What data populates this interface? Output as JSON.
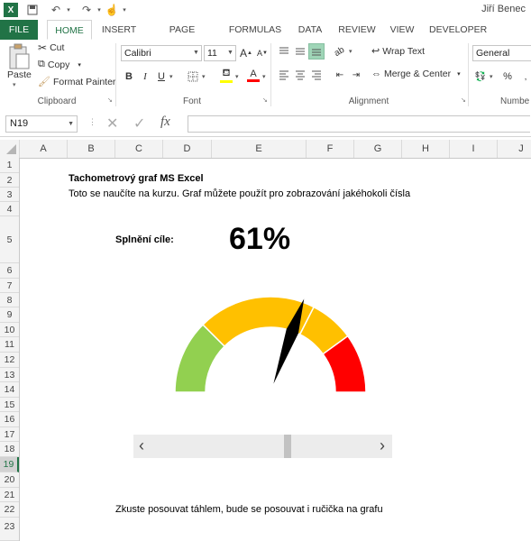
{
  "window": {
    "user_name": "Jiří Benec"
  },
  "tabs": [
    "FILE",
    "HOME",
    "INSERT",
    "PAGE LAYOUT",
    "FORMULAS",
    "DATA",
    "REVIEW",
    "VIEW",
    "DEVELOPER"
  ],
  "clipboard": {
    "paste": "Paste",
    "cut": "Cut",
    "copy": "Copy",
    "format_painter": "Format Painter",
    "group": "Clipboard"
  },
  "font": {
    "name": "Calibri",
    "size": "11",
    "group": "Font",
    "bold": "B",
    "italic": "I",
    "underline": "U",
    "grow": "A",
    "shrink": "A"
  },
  "alignment": {
    "wrap": "Wrap Text",
    "merge": "Merge & Center",
    "group": "Alignment"
  },
  "number": {
    "format": "General",
    "group": "Numbe",
    "percent": "%"
  },
  "formula_bar": {
    "name_box": "N19",
    "fx": "fx",
    "value": ""
  },
  "columns": [
    "A",
    "B",
    "C",
    "D",
    "E",
    "F",
    "G",
    "H",
    "I",
    "J"
  ],
  "rows": [
    "1",
    "2",
    "3",
    "4",
    "5",
    "6",
    "7",
    "8",
    "9",
    "10",
    "11",
    "12",
    "13",
    "14",
    "15",
    "16",
    "17",
    "18",
    "19",
    "20",
    "21",
    "22",
    "23"
  ],
  "selected_cell": {
    "column": "N",
    "row": "19"
  },
  "sheet": {
    "title": "Tachometrový graf MS Excel",
    "subtitle": "Toto se naučíte na kurzu. Graf můžete použít pro zobrazování jakéhokoli čísla",
    "goal_label": "Splnění cíle:",
    "goal_value": "61%",
    "hint": "Zkuste posouvat táhlem, bude se posouvat i ručička na grafu"
  },
  "gauge": {
    "value": 0.61,
    "segments": [
      {
        "from": 0.0,
        "to": 0.25,
        "color": "#92d050"
      },
      {
        "from": 0.25,
        "to": 0.65,
        "color": "#ffc000"
      },
      {
        "from": 0.65,
        "to": 0.8,
        "color": "#ffc000"
      },
      {
        "from": 0.8,
        "to": 1.0,
        "color": "#ff0000"
      }
    ],
    "needle_color": "#000000"
  },
  "scrollbar": {
    "value": 0.61,
    "left_arrow": "‹",
    "right_arrow": "›"
  }
}
